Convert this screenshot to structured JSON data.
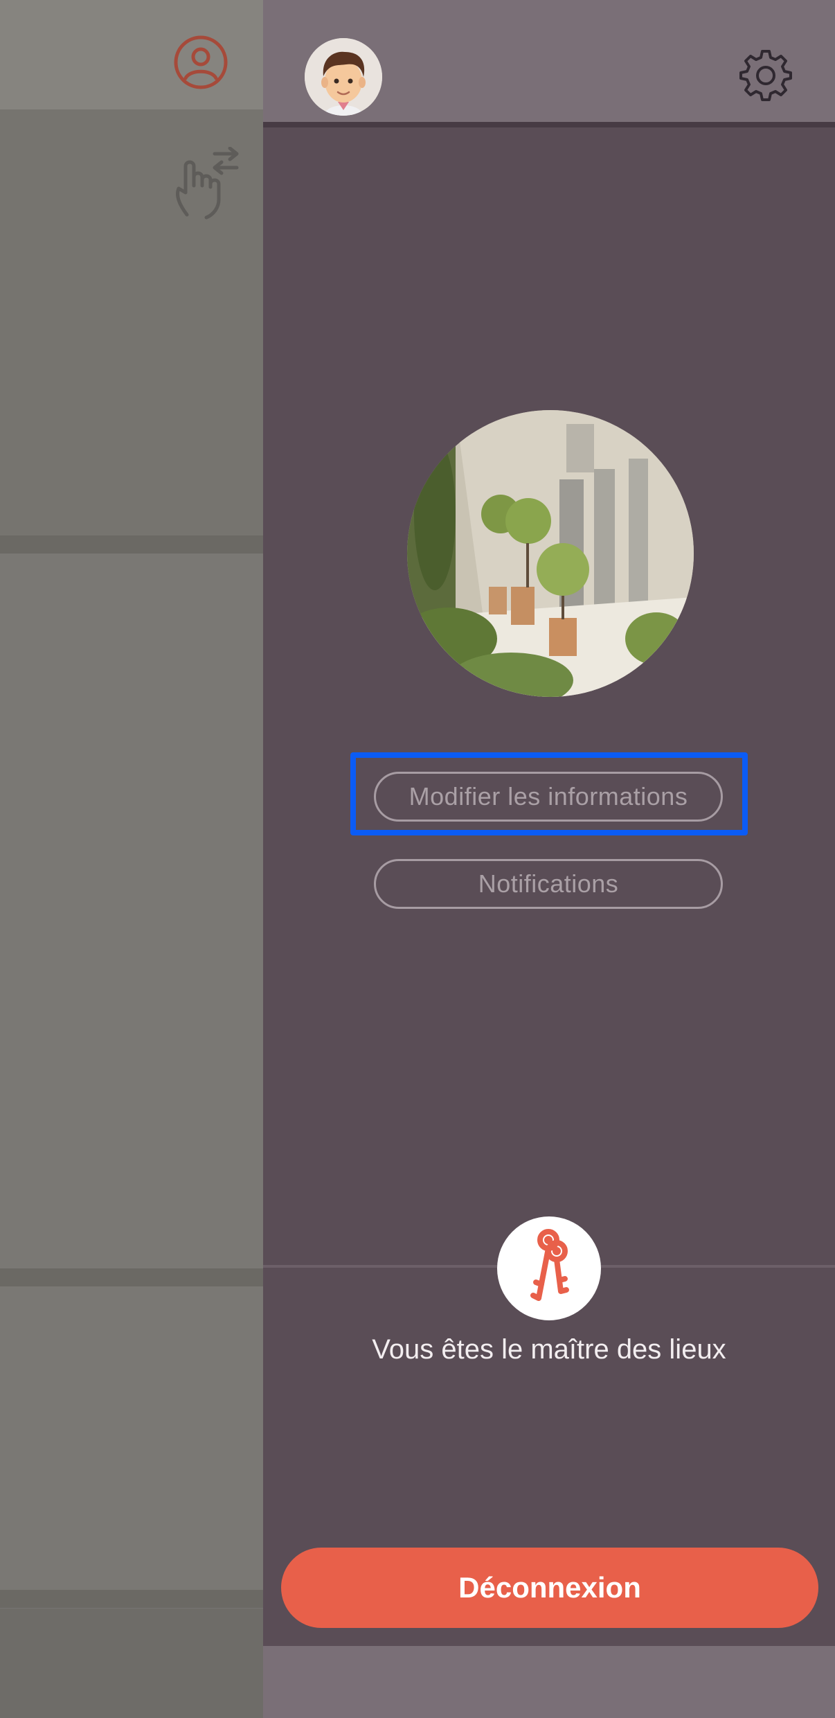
{
  "drawer": {
    "edit_info_label": "Modifier les informations",
    "notifications_label": "Notifications",
    "owner_status_text": "Vous êtes le maître des lieux",
    "logout_label": "Déconnexion"
  },
  "icons": {
    "profile": "user-circle-icon",
    "gesture": "swipe-icon",
    "settings": "gear-icon",
    "status": "keys-icon"
  },
  "colors": {
    "accent": "#e8604a",
    "drawer_bg": "#5a4d56",
    "highlight": "#0b5cf5"
  }
}
